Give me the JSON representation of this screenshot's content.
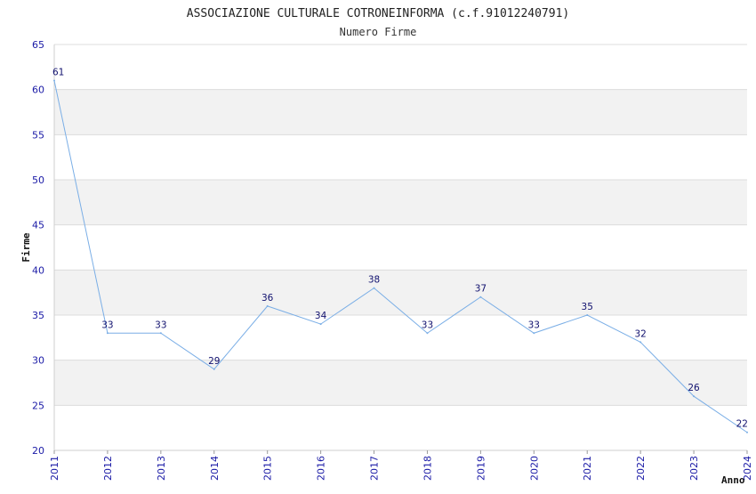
{
  "chart_data": {
    "type": "line",
    "title": "ASSOCIAZIONE CULTURALE COTRONEINFORMA (c.f.91012240791)",
    "subtitle": "Numero Firme",
    "xlabel": "Anno",
    "ylabel": "Firme",
    "x": [
      "2011",
      "2012",
      "2013",
      "2014",
      "2015",
      "2016",
      "2017",
      "2018",
      "2019",
      "2020",
      "2021",
      "2022",
      "2023",
      "2024"
    ],
    "values": [
      61,
      33,
      33,
      29,
      36,
      34,
      38,
      33,
      37,
      33,
      35,
      32,
      26,
      22
    ],
    "ylim": [
      20,
      65
    ],
    "yticks": [
      20,
      25,
      30,
      35,
      40,
      45,
      50,
      55,
      60,
      65
    ],
    "grid": true,
    "line_color": "#7aaee6",
    "band_color": "#f2f2f2",
    "grid_color": "#dcdcdc",
    "tick_label_color": "#1a1aa6",
    "data_label_color": "#10106e"
  }
}
